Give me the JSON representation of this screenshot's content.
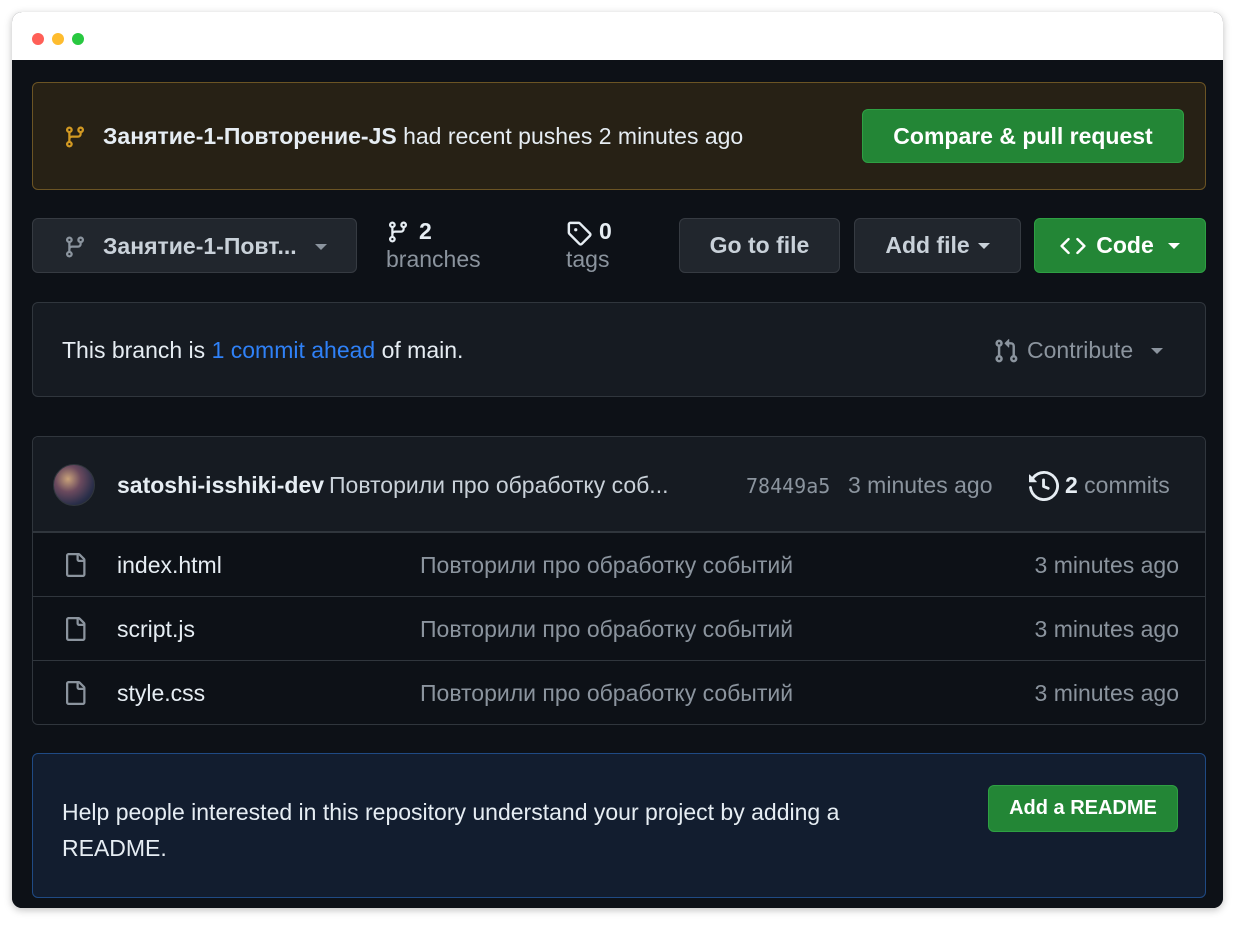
{
  "banner": {
    "branch_name": "Занятие-1-Повторение-JS",
    "message": " had recent pushes 2 minutes ago",
    "button_label": "Compare & pull request"
  },
  "toolbar": {
    "branch_select_label": "Занятие-1-Повт...",
    "branches_count": "2",
    "branches_word": "branches",
    "tags_count": "0",
    "tags_word": "tags",
    "go_to_file_label": "Go to file",
    "add_file_label": "Add file",
    "code_label": "Code"
  },
  "ahead": {
    "prefix": "This branch is ",
    "link": "1 commit ahead",
    "suffix": " of main.",
    "contribute_label": "Contribute"
  },
  "commit": {
    "author": "satoshi-isshiki-dev",
    "message": "Повторили про обработку соб...",
    "sha": "78449a5",
    "time": "3 minutes ago",
    "commits_count": "2",
    "commits_word": " commits"
  },
  "files": [
    {
      "name": "index.html",
      "message": "Повторили про обработку событий",
      "time": "3 minutes ago"
    },
    {
      "name": "script.js",
      "message": "Повторили про обработку событий",
      "time": "3 minutes ago"
    },
    {
      "name": "style.css",
      "message": "Повторили про обработку событий",
      "time": "3 minutes ago"
    }
  ],
  "readme": {
    "text": "Help people interested in this repository understand your project by adding a README.",
    "button_label": "Add a README"
  },
  "colors": {
    "accent_green": "#238636",
    "link_blue": "#2f81f7",
    "banner_bg": "#272115",
    "page_bg": "#0d1117"
  },
  "icons": {
    "branch": "git-branch-icon",
    "tag": "tag-icon",
    "code": "code-icon",
    "contribute": "git-pull-request-icon",
    "history": "history-icon",
    "file": "file-icon"
  }
}
